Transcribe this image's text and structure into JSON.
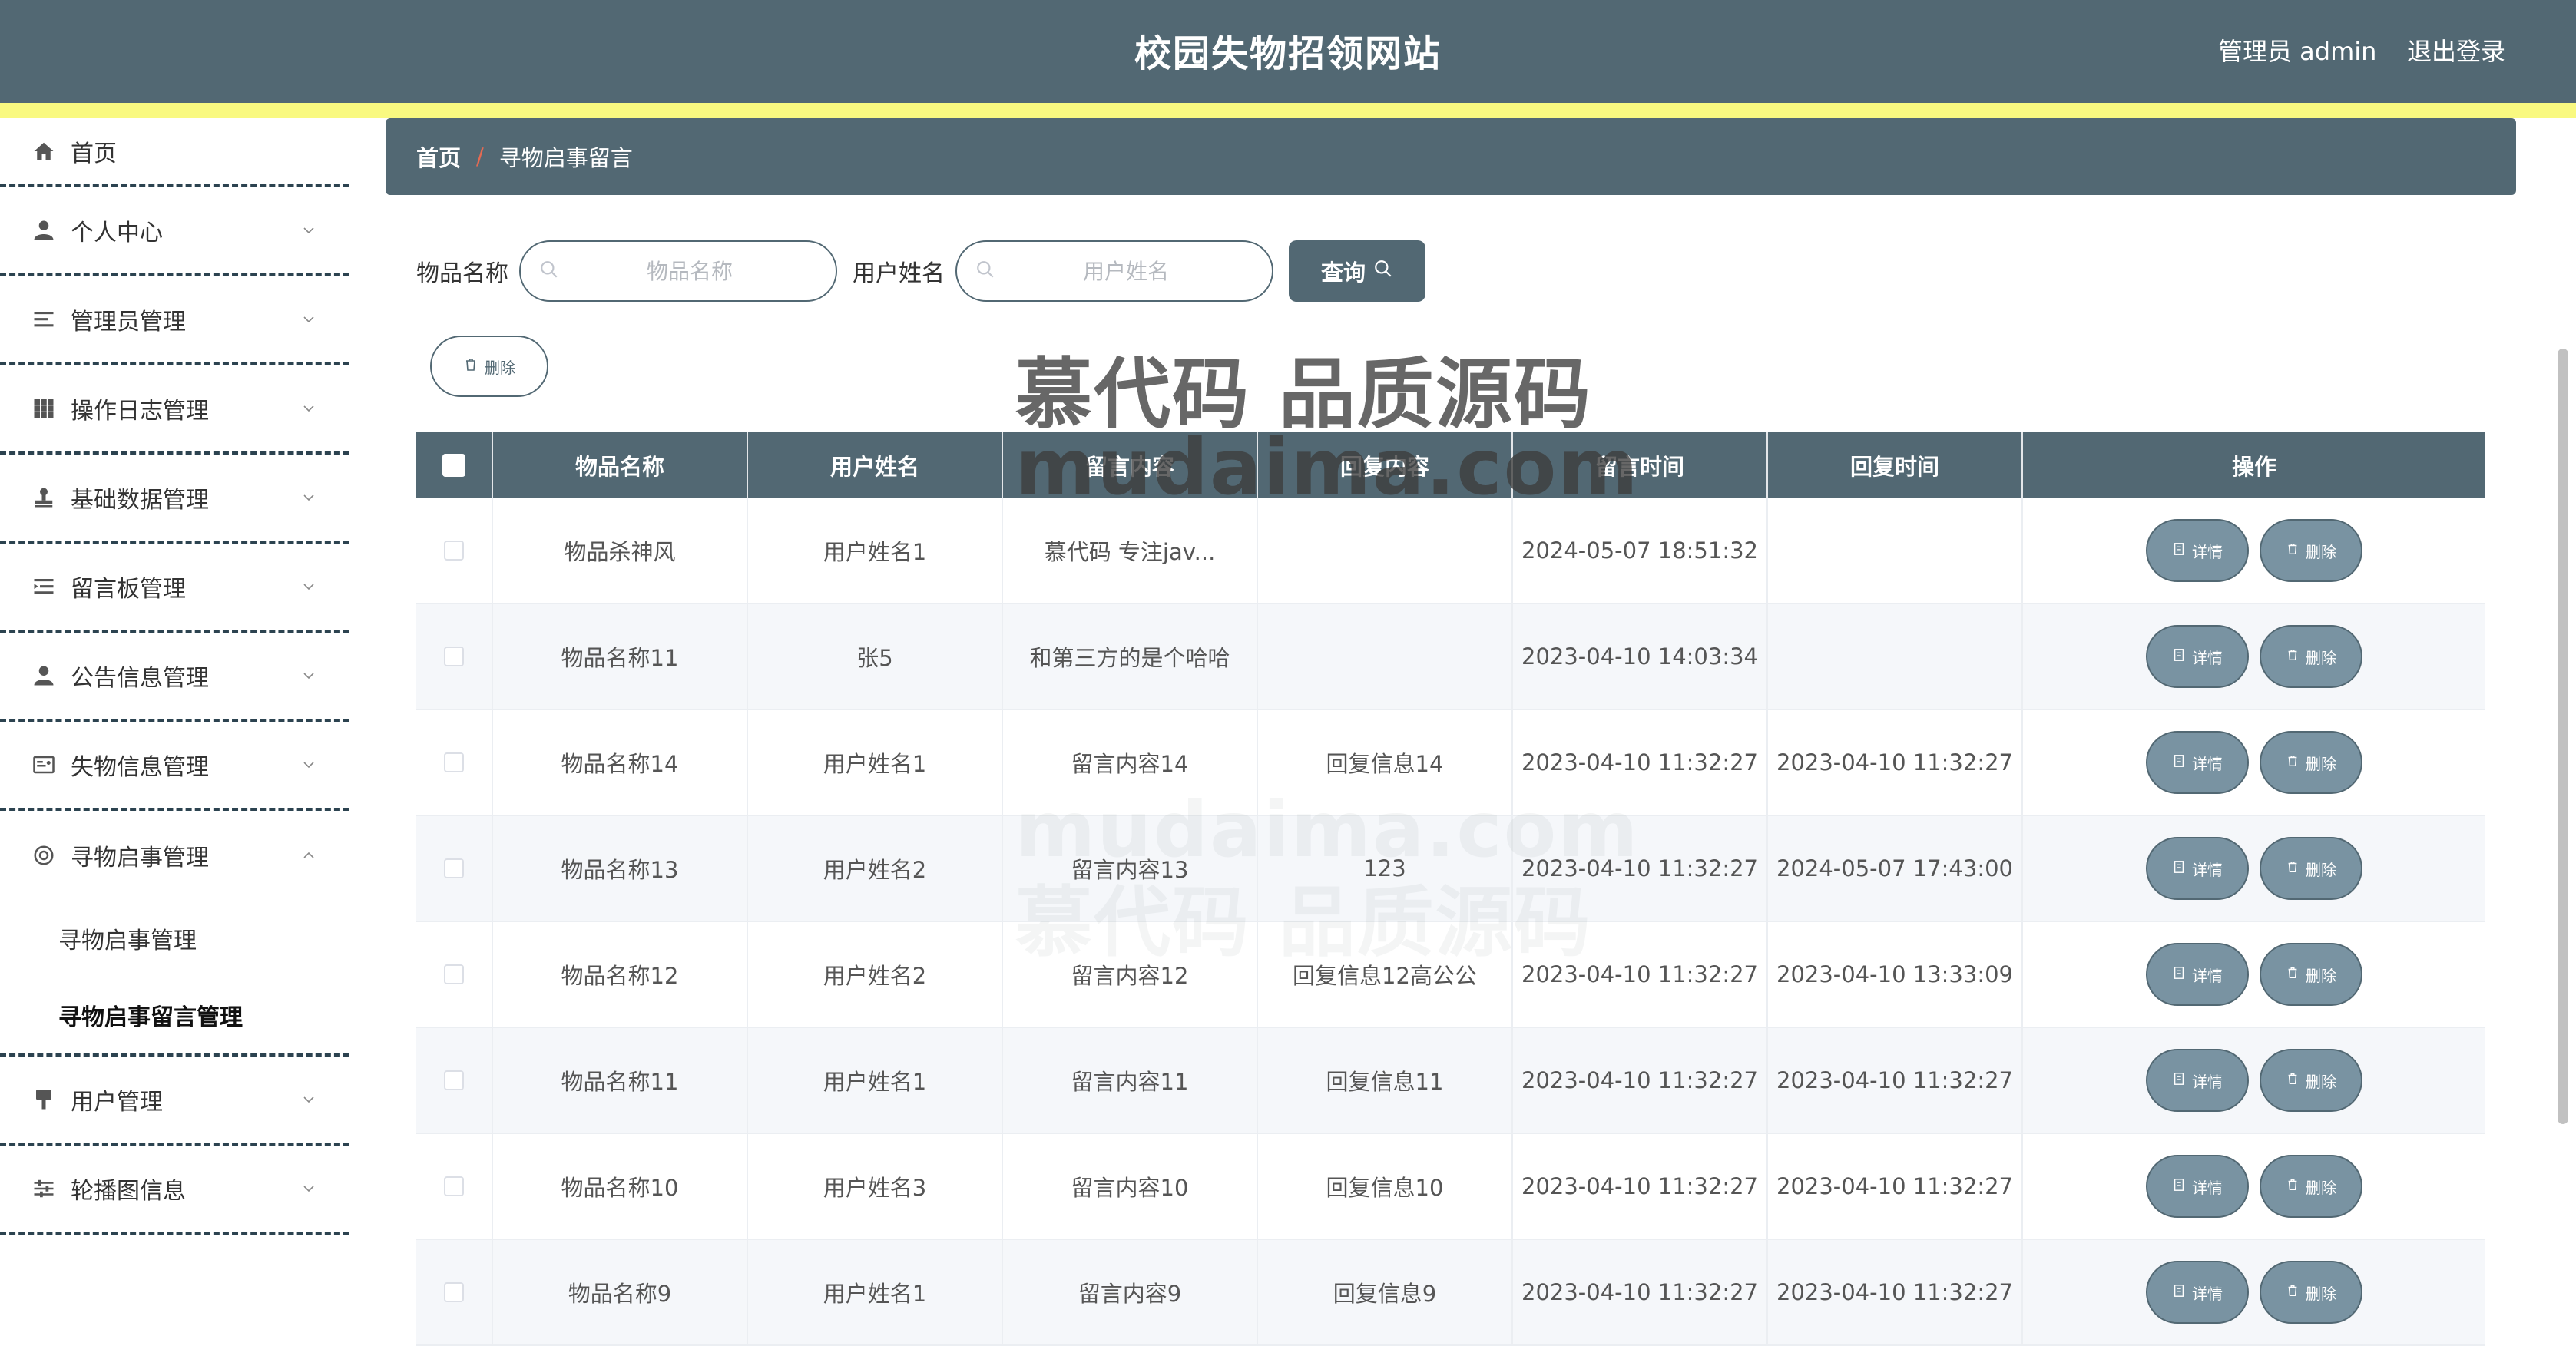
{
  "header": {
    "title": "校园失物招领网站",
    "admin": "管理员 admin",
    "logout": "退出登录"
  },
  "sidebar": {
    "items": [
      {
        "label": "首页",
        "icon": "home-icon"
      },
      {
        "label": "个人中心",
        "icon": "user-icon"
      },
      {
        "label": "管理员管理",
        "icon": "list-icon"
      },
      {
        "label": "操作日志管理",
        "icon": "grid-icon"
      },
      {
        "label": "基础数据管理",
        "icon": "stamp-icon"
      },
      {
        "label": "留言板管理",
        "icon": "indent-icon"
      },
      {
        "label": "公告信息管理",
        "icon": "user-icon"
      },
      {
        "label": "失物信息管理",
        "icon": "card-icon"
      },
      {
        "label": "寻物启事管理",
        "icon": "lifebuoy-icon"
      },
      {
        "label": "用户管理",
        "icon": "brush-icon"
      },
      {
        "label": "轮播图信息",
        "icon": "sliders-icon"
      }
    ],
    "submenu": [
      "寻物启事管理",
      "寻物启事留言管理"
    ]
  },
  "breadcrumb": {
    "home": "首页",
    "separator": "/",
    "current": "寻物启事留言"
  },
  "search": {
    "item_label": "物品名称",
    "item_placeholder": "物品名称",
    "user_label": "用户姓名",
    "user_placeholder": "用户姓名",
    "query": "查询"
  },
  "delete_label": "删除",
  "watermark": {
    "line1": "慕代码 品质源码",
    "line2": "mudaima.com"
  },
  "table": {
    "headers": [
      "物品名称",
      "用户姓名",
      "留言内容",
      "回复内容",
      "留言时间",
      "回复时间",
      "操作"
    ],
    "detail_label": "详情",
    "delete_label": "删除",
    "rows": [
      [
        "物品杀神风",
        "用户姓名1",
        "慕代码 专注jav...",
        "",
        "2024-05-07 18:51:32",
        ""
      ],
      [
        "物品名称11",
        "张5",
        "和第三方的是个哈哈",
        "",
        "2023-04-10 14:03:34",
        ""
      ],
      [
        "物品名称14",
        "用户姓名1",
        "留言内容14",
        "回复信息14",
        "2023-04-10 11:32:27",
        "2023-04-10 11:32:27"
      ],
      [
        "物品名称13",
        "用户姓名2",
        "留言内容13",
        "123",
        "2023-04-10 11:32:27",
        "2024-05-07 17:43:00"
      ],
      [
        "物品名称12",
        "用户姓名2",
        "留言内容12",
        "回复信息12高公公",
        "2023-04-10 11:32:27",
        "2023-04-10 13:33:09"
      ],
      [
        "物品名称11",
        "用户姓名1",
        "留言内容11",
        "回复信息11",
        "2023-04-10 11:32:27",
        "2023-04-10 11:32:27"
      ],
      [
        "物品名称10",
        "用户姓名3",
        "留言内容10",
        "回复信息10",
        "2023-04-10 11:32:27",
        "2023-04-10 11:32:27"
      ],
      [
        "物品名称9",
        "用户姓名1",
        "留言内容9",
        "回复信息9",
        "2023-04-10 11:32:27",
        "2023-04-10 11:32:27"
      ]
    ]
  },
  "colors": {
    "primary": "#526873",
    "accent_stripe": "#f9f980",
    "button": "#7993a2"
  }
}
